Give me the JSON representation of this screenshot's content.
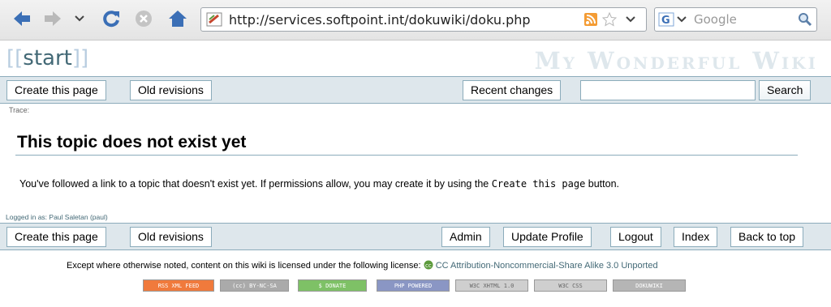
{
  "browser": {
    "url": "http://services.softpoint.int/dokuwiki/doku.php",
    "search_placeholder": "Google"
  },
  "wiki": {
    "title_open": "[[",
    "title_word": "start",
    "title_close": "]]",
    "site_name": "My Wonderful Wiki"
  },
  "top_bar": {
    "create_label": "Create this page",
    "old_revisions_label": "Old revisions",
    "recent_changes_label": "Recent changes",
    "search_value": "",
    "search_label": "Search"
  },
  "breadcrumb": "Trace:",
  "content": {
    "heading": "This topic does not exist yet",
    "text_before": "You've followed a link to a topic that doesn't exist yet. If permissions allow, you may create it by using the ",
    "text_code": "Create this page",
    "text_after": " button."
  },
  "login_info": "Logged in as: Paul Saletan (paul)",
  "bottom_bar": {
    "create_label": "Create this page",
    "old_revisions_label": "Old revisions",
    "admin_label": "Admin",
    "update_profile_label": "Update Profile",
    "logout_label": "Logout",
    "index_label": "Index",
    "back_to_top_label": "Back to top"
  },
  "footer": {
    "license_text": "Except where otherwise noted, content on this wiki is licensed under the following license: ",
    "license_link": "CC Attribution-Noncommercial-Share Alike 3.0 Unported",
    "badges": [
      {
        "label": "RSS XML FEED",
        "color": "#f07a3c"
      },
      {
        "label": "(cc) BY-NC-SA",
        "color": "#aaaaaa"
      },
      {
        "label": "$ DONATE",
        "color": "#7ec166"
      },
      {
        "label": "PHP POWERED",
        "color": "#8a96c4"
      },
      {
        "label": "W3C XHTML 1.0",
        "color": "#cfcfcf"
      },
      {
        "label": "W3C CSS",
        "color": "#cfcfcf"
      },
      {
        "label": "DOKUWIKI",
        "color": "#b5b5b5"
      }
    ]
  },
  "colors": {
    "link": "#436976",
    "bar_bg": "#dee7ec",
    "bar_border": "#8cacbb"
  }
}
